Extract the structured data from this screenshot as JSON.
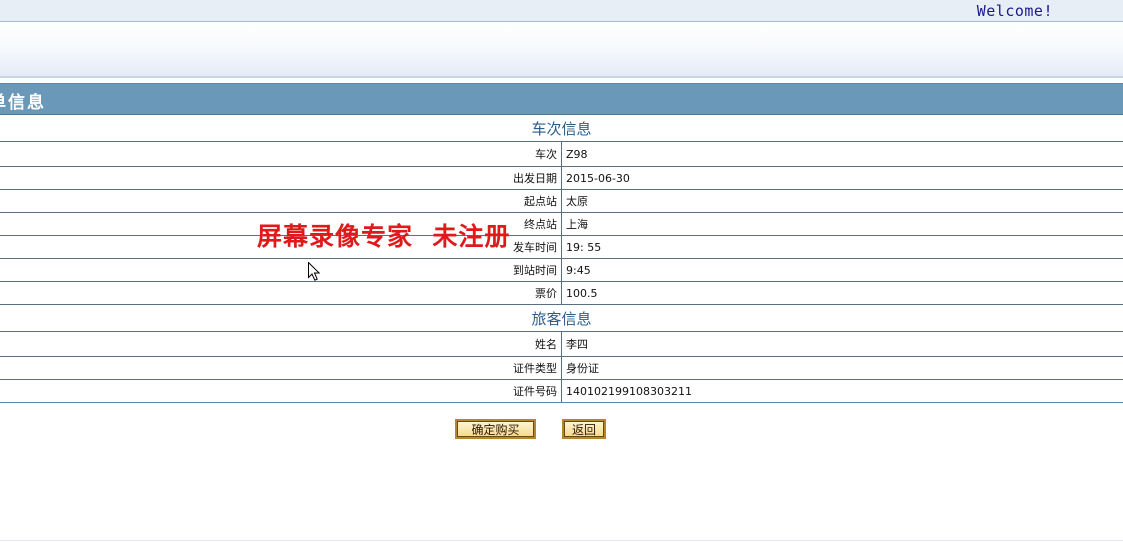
{
  "header": {
    "welcome": "Welcome!"
  },
  "panel": {
    "title": "单信息"
  },
  "train_section": {
    "title": "车次信息",
    "rows": [
      {
        "label": "车次",
        "value": "Z98"
      },
      {
        "label": "出发日期",
        "value": "2015-06-30"
      },
      {
        "label": "起点站",
        "value": "太原"
      },
      {
        "label": "终点站",
        "value": "上海"
      },
      {
        "label": "发车时间",
        "value": "19: 55"
      },
      {
        "label": "到站时间",
        "value": "9:45"
      },
      {
        "label": "票价",
        "value": "100.5"
      }
    ]
  },
  "passenger_section": {
    "title": "旅客信息",
    "rows": [
      {
        "label": "姓名",
        "value": "李四"
      },
      {
        "label": "证件类型",
        "value": "身份证"
      },
      {
        "label": "证件号码",
        "value": "140102199108303211"
      }
    ]
  },
  "actions": {
    "confirm_label": "确定购买",
    "back_label": "返回"
  },
  "watermark": {
    "text": "屏幕录像专家  未注册"
  },
  "colors": {
    "header_bar": "#6a98b8",
    "section_title": "#2c5d8a",
    "watermark": "#e0191a",
    "button_border": "#b8862a"
  },
  "icons": {
    "cursor": "mouse-pointer-icon"
  }
}
